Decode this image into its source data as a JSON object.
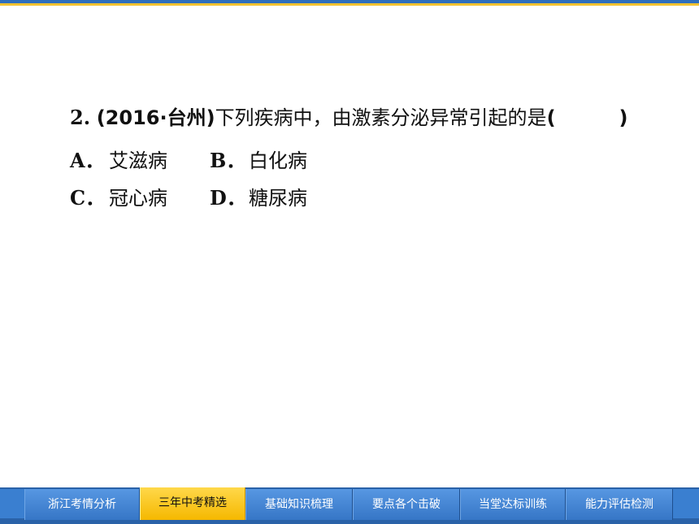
{
  "header": {
    "accent_blue": "#2f6fbe",
    "accent_yellow": "#f2c230"
  },
  "question": {
    "number": "2.",
    "source": "(2016·台州)",
    "stem": "下列疾病中，由激素分泌异常引起的是",
    "open_paren": "(",
    "close_paren": ")"
  },
  "options": [
    {
      "letter": "A．",
      "text": "艾滋病"
    },
    {
      "letter": "B．",
      "text": "白化病"
    },
    {
      "letter": "C．",
      "text": "冠心病"
    },
    {
      "letter": "D．",
      "text": "糖尿病"
    }
  ],
  "nav": {
    "active_tab": "三年中考精选",
    "active_color": "#f5b800",
    "tab_color": "#3a7fd0",
    "tabs": [
      {
        "label": "浙江考情分析"
      },
      {
        "label": "三年中考精选"
      },
      {
        "label": "基础知识梳理"
      },
      {
        "label": "要点各个击破"
      },
      {
        "label": "当堂达标训练"
      },
      {
        "label": "能力评估检测"
      }
    ]
  }
}
